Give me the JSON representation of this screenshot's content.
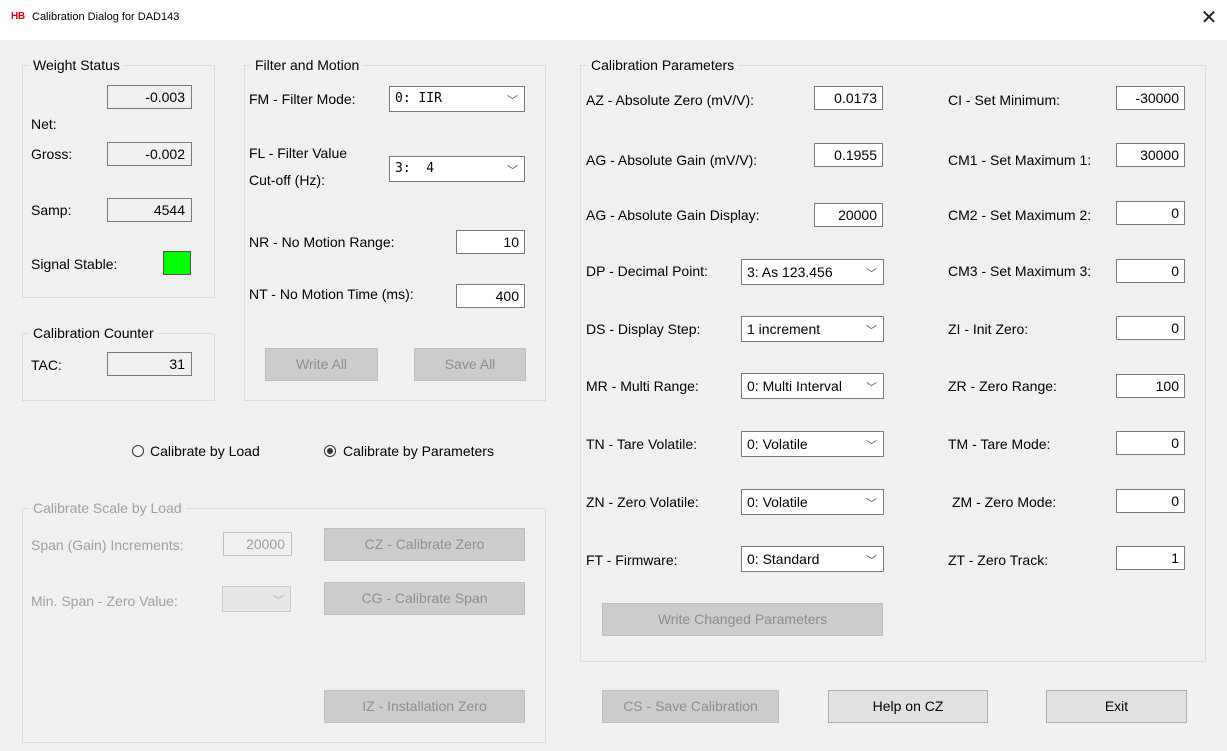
{
  "window": {
    "logo": "HB",
    "title": "Calibration Dialog for DAD143",
    "close_glyph": "✕"
  },
  "weight_status": {
    "title": "Weight Status",
    "net_label": "Net:",
    "net_value": "-0.003",
    "gross_label": "Gross:",
    "gross_value": "-0.002",
    "samp_label": "Samp:",
    "samp_value": "4544",
    "stable_label": "Signal Stable:",
    "stable_color": "#00ff00"
  },
  "calibration_counter": {
    "title": "Calibration Counter",
    "tac_label": "TAC:",
    "tac_value": "31"
  },
  "filter_motion": {
    "title": "Filter and Motion",
    "fm_label": "FM - Filter Mode:",
    "fm_value": "0: IIR",
    "fl_label_1": "FL - Filter Value",
    "fl_label_2": "Cut-off (Hz):",
    "fl_value": "3:  4",
    "nr_label": "NR - No Motion Range:",
    "nr_value": "10",
    "nt_label": "NT - No Motion Time (ms):",
    "nt_value": "400",
    "write_all": "Write All",
    "save_all": "Save All"
  },
  "mode": {
    "by_load": "Calibrate by Load",
    "by_params": "Calibrate by Parameters",
    "selected": "by_params"
  },
  "scale_by_load": {
    "title": "Calibrate Scale by Load",
    "span_label": "Span (Gain) Increments:",
    "span_value": "20000",
    "min_span_label": "Min. Span - Zero Value:",
    "min_span_value": "",
    "cz_button": "CZ - Calibrate Zero",
    "cg_button": "CG - Calibrate Span",
    "iz_button": "IZ - Installation Zero"
  },
  "calibration_parameters": {
    "title": "Calibration Parameters",
    "az_label": "AZ - Absolute Zero (mV/V):",
    "az_value": "0.0173",
    "ag_label": "AG - Absolute Gain (mV/V):",
    "ag_value": "0.1955",
    "agd_label": "AG - Absolute Gain Display:",
    "agd_value": "20000",
    "dp_label": "DP - Decimal Point:",
    "dp_value": "3: As 123.456",
    "ds_label": "DS - Display Step:",
    "ds_value": "1 increment",
    "mr_label": "MR - Multi Range:",
    "mr_value": "0: Multi Interval",
    "tn_label": "TN - Tare Volatile:",
    "tn_value": "0: Volatile",
    "zn_label": "ZN - Zero Volatile:",
    "zn_value": "0: Volatile",
    "ft_label": "FT - Firmware:",
    "ft_value": "0: Standard",
    "ci_label": "CI - Set Minimum:",
    "ci_value": "-30000",
    "cm1_label": "CM1 - Set Maximum 1:",
    "cm1_value": "30000",
    "cm2_label": "CM2 - Set Maximum 2:",
    "cm2_value": "0",
    "cm3_label": "CM3 - Set Maximum 3:",
    "cm3_value": "0",
    "zi_label": "ZI - Init Zero:",
    "zi_value": "0",
    "zr_label": "ZR - Zero Range:",
    "zr_value": "100",
    "tm_label": "TM - Tare Mode:",
    "tm_value": "0",
    "zm_label": "ZM - Zero Mode:",
    "zm_value": "0",
    "zt_label": "ZT - Zero Track:",
    "zt_value": "1",
    "write_changed": "Write Changed Parameters"
  },
  "footer": {
    "cs_button": "CS - Save Calibration",
    "help_button": "Help on CZ",
    "exit_button": "Exit"
  },
  "icons": {
    "dropdown": "chevron-down-icon",
    "chevron_glyph": "﹀"
  }
}
